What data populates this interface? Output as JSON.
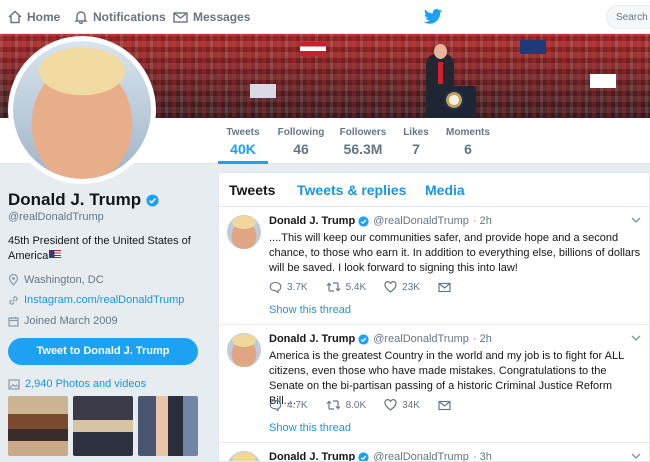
{
  "nav": {
    "home": "Home",
    "notifications": "Notifications",
    "messages": "Messages",
    "search_placeholder": "Search Tw"
  },
  "stats": [
    {
      "label": "Tweets",
      "value": "40K",
      "active": true
    },
    {
      "label": "Following",
      "value": "46"
    },
    {
      "label": "Followers",
      "value": "56.3M"
    },
    {
      "label": "Likes",
      "value": "7"
    },
    {
      "label": "Moments",
      "value": "6"
    }
  ],
  "profile": {
    "name": "Donald J. Trump",
    "handle": "@realDonaldTrump",
    "bio": "45th President of the United States of America",
    "location": "Washington, DC",
    "website": "Instagram.com/realDonaldTrump",
    "joined": "Joined March 2009",
    "tweet_to": "Tweet to Donald J. Trump",
    "photos": "2,940 Photos and videos"
  },
  "tabs": [
    "Tweets",
    "Tweets & replies",
    "Media"
  ],
  "tweets": [
    {
      "name": "Donald J. Trump",
      "handle": "@realDonaldTrump",
      "time": "· 2h",
      "text": "....This will keep our communities safer, and provide hope and a second chance, to those who earn it. In addition to everything else, billions of dollars will be saved. I look forward to signing this into law!",
      "replies": "3.7K",
      "retweets": "5.4K",
      "likes": "23K",
      "show_thread": "Show this thread"
    },
    {
      "name": "Donald J. Trump",
      "handle": "@realDonaldTrump",
      "time": "· 2h",
      "text": "America is the greatest Country in the world and my job is to fight for ALL citizens, even those who have made mistakes. Congratulations to the Senate on the bi-partisan passing of a historic Criminal Justice Reform Bill....",
      "replies": "4.7K",
      "retweets": "8.0K",
      "likes": "34K",
      "show_thread": "Show this thread"
    },
    {
      "name": "Donald J. Trump",
      "handle": "@realDonaldTrump",
      "time": "· 3h"
    }
  ],
  "colors": {
    "accent": "#1da1f2",
    "link": "#1b95e0",
    "background": "#e6ecf0"
  }
}
